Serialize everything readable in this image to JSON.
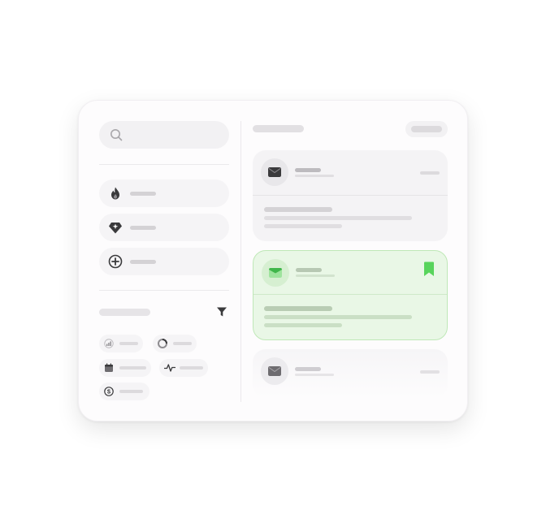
{
  "colors": {
    "card_background": "#fdfcfd",
    "placeholder_bar": "#dcdadd",
    "selected_message_background": "#e9f7e6",
    "selected_message_border": "#bfe8b7",
    "accent_green": "#58d45c",
    "icon_dark": "#3a3a3c"
  },
  "sidebar": {
    "search": {
      "icon": "search-icon",
      "placeholder": ""
    },
    "nav_items": [
      {
        "icon": "flame-icon"
      },
      {
        "icon": "diamond-sparkle-icon"
      },
      {
        "icon": "plus-circle-icon"
      }
    ],
    "filter_section": {
      "filter_icon": "filter-icon",
      "chips": [
        {
          "icon": "signal-icon"
        },
        {
          "icon": "pie-icon"
        },
        {
          "icon": "calendar-icon"
        },
        {
          "icon": "activity-icon"
        },
        {
          "icon": "dollar-icon"
        }
      ]
    }
  },
  "main": {
    "messages": [
      {
        "icon": "envelope-icon",
        "selected": false,
        "bookmarked": false
      },
      {
        "icon": "envelope-icon",
        "selected": true,
        "bookmarked": true,
        "bookmark_icon": "bookmark-icon"
      },
      {
        "icon": "envelope-icon",
        "selected": false,
        "bookmarked": false
      }
    ]
  }
}
